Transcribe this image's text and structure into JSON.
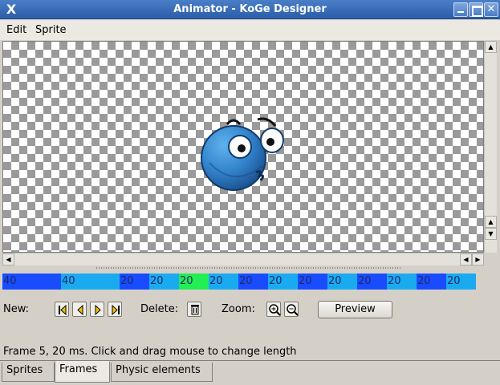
{
  "window": {
    "title": "Animator - KoGe Designer",
    "app_icon": "X"
  },
  "menu": {
    "items": [
      "Edit",
      "Sprite"
    ]
  },
  "timeline": {
    "frames": [
      {
        "label": "40",
        "color": "#1a4cff",
        "state": "normal"
      },
      {
        "label": "40",
        "color": "#1aaaf0",
        "state": "normal"
      },
      {
        "label": "20",
        "color": "#1a4cff",
        "state": "normal"
      },
      {
        "label": "20",
        "color": "#1aaaf0",
        "state": "normal"
      },
      {
        "label": "20",
        "color": "#22ee55",
        "state": "selected"
      },
      {
        "label": "20",
        "color": "#1aaaf0",
        "state": "normal"
      },
      {
        "label": "20",
        "color": "#1a4cff",
        "state": "normal"
      },
      {
        "label": "20",
        "color": "#1aaaf0",
        "state": "normal"
      },
      {
        "label": "20",
        "color": "#1a4cff",
        "state": "normal"
      },
      {
        "label": "20",
        "color": "#1aaaf0",
        "state": "normal"
      },
      {
        "label": "20",
        "color": "#1a4cff",
        "state": "normal"
      },
      {
        "label": "20",
        "color": "#1aaaf0",
        "state": "normal"
      },
      {
        "label": "20",
        "color": "#1a4cff",
        "state": "normal"
      },
      {
        "label": "20",
        "color": "#1aaaf0",
        "state": "normal"
      }
    ]
  },
  "controls": {
    "new_label": "New:",
    "delete_label": "Delete:",
    "zoom_label": "Zoom:",
    "preview_label": "Preview",
    "new_buttons": [
      "insert-first-frame-icon",
      "insert-before-icon",
      "insert-after-icon",
      "insert-last-frame-icon"
    ],
    "delete_button": "trash-icon",
    "zoom_buttons": [
      "zoom-in-icon",
      "zoom-out-icon"
    ]
  },
  "status": {
    "text": "Frame 5, 20 ms. Click and drag mouse to change length"
  },
  "tabs": [
    {
      "label": "Sprites",
      "active": false
    },
    {
      "label": "Frames",
      "active": true
    },
    {
      "label": "Physic elements",
      "active": false
    }
  ],
  "colors": {
    "titlebar": "#3a6db8",
    "sprite_body": "#2f7fc8",
    "selected_frame": "#22ee55"
  }
}
